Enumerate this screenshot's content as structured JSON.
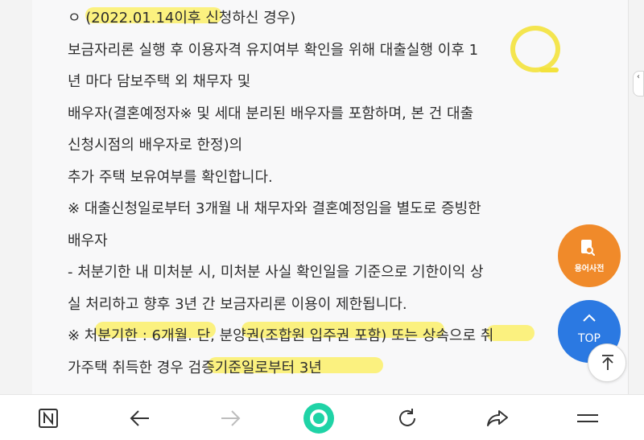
{
  "article": {
    "lines": [
      "ㅇ (2022.01.14이후 신청하신 경우)",
      "보금자리론 실행 후 이용자격 유지여부 확인을 위해 대출실행 이후 1",
      "년 마다 담보주택 외 채무자 및",
      "배우자(결혼예정자※ 및 세대 분리된 배우자를 포함하며, 본 건 대출",
      "신청시점의 배우자로 한정)의",
      "추가 주택 보유여부를 확인합니다.",
      "※ 대출신청일로부터 3개월 내 채무자와 결혼예정임을 별도로 증빙한",
      "배우자",
      "- 처분기한 내 미처분 시, 미처분 사실 확인일을 기준으로 기한이익 상",
      "실 처리하고 향후 3년 간 보금자리론 이용이 제한됩니다.",
      "※ 처분기한 : 6개월. 단, 분양권(조합원 입주권 포함) 또는 상속으로 취",
      "가주택 취득한 경우 검증기준일로부터 3년"
    ]
  },
  "floating": {
    "dictionary_label": "용어사전",
    "top_label": "TOP"
  },
  "colors": {
    "highlight": "#fbf06a",
    "dictionary_button": "#f08a2a",
    "top_button": "#2b79e2",
    "home_button": "#1fd3a6"
  },
  "bottom_nav": {
    "icons": [
      "naver-n-icon",
      "back-arrow-icon",
      "forward-arrow-icon",
      "home-ring-icon",
      "refresh-icon",
      "share-icon",
      "menu-icon"
    ]
  }
}
